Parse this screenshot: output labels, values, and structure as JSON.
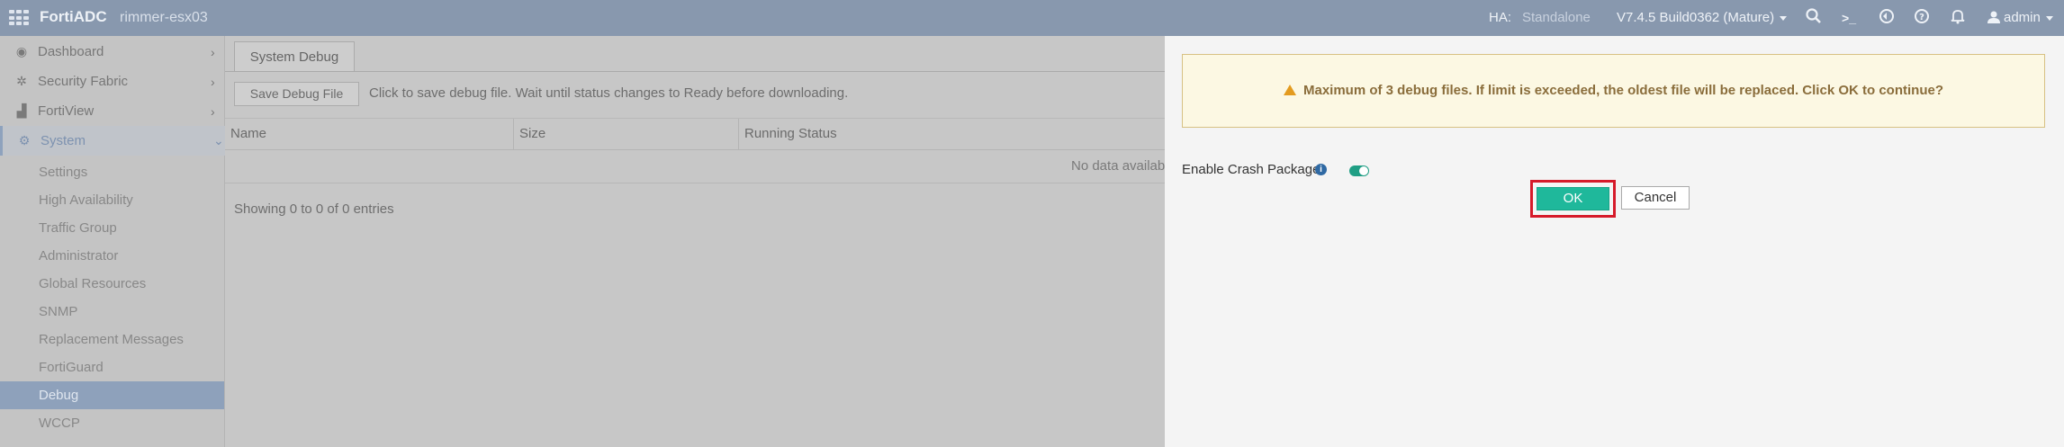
{
  "topbar": {
    "brand": "FortiADC",
    "hostname": "rimmer-esx03",
    "ha_label": "HA:",
    "ha_value": "Standalone",
    "version": "V7.4.5 Build0362 (Mature)",
    "user": "admin",
    "icons": [
      "search-icon",
      "cli-console-icon",
      "refresh-icon",
      "help-icon",
      "bell-icon",
      "user-icon"
    ]
  },
  "sidebar": {
    "items": [
      {
        "label": "Dashboard",
        "icon": "dashboard-icon"
      },
      {
        "label": "Security Fabric",
        "icon": "fabric-icon"
      },
      {
        "label": "FortiView",
        "icon": "chart-icon"
      },
      {
        "label": "System",
        "icon": "gear-icon"
      }
    ],
    "sub_items": [
      "Settings",
      "High Availability",
      "Traffic Group",
      "Administrator",
      "Global Resources",
      "SNMP",
      "Replacement Messages",
      "FortiGuard",
      "Debug",
      "WCCP"
    ],
    "selected_sub_item": "Debug"
  },
  "main": {
    "tab_label": "System Debug",
    "save_button": "Save Debug File",
    "hint": "Click to save debug file. Wait until status changes to Ready before downloading.",
    "columns": [
      "Name",
      "Size",
      "Running Status"
    ],
    "no_data": "No data available",
    "showing": "Showing 0 to 0 of 0 entries"
  },
  "dialog": {
    "warning": "Maximum of 3 debug files. If limit is exceeded, the oldest file will be replaced. Click OK to continue?",
    "crash_label": "Enable Crash Package",
    "crash_enabled": true,
    "ok_label": "OK",
    "cancel_label": "Cancel"
  },
  "colors": {
    "topbar": "#8898ae",
    "accent": "#1fb89b",
    "highlight_border": "#d61a2a",
    "warning_bg": "#fcf8e3"
  }
}
